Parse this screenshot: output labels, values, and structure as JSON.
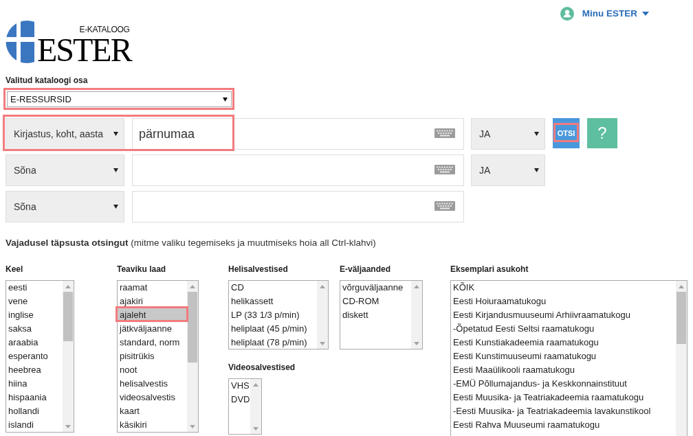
{
  "user_menu": {
    "label": "Minu ESTER"
  },
  "logo": {
    "subtitle": "E-KATALOOG",
    "title": "ESTER"
  },
  "catalog_section": {
    "label": "Valitud kataloogi osa",
    "value": "E-RESSURSID",
    "highlighted": true
  },
  "search_rows": [
    {
      "field": "Kirjastus, koht, aasta",
      "value": "pärnumaa",
      "operator": "JA",
      "highlighted": true
    },
    {
      "field": "Sõna",
      "operator": "JA",
      "highlighted": false
    },
    {
      "field": "Sõna",
      "highlighted": false
    }
  ],
  "search_button": {
    "label": "OTSI",
    "highlighted": true
  },
  "help_button": {
    "label": "?"
  },
  "refine_hint": "**Vajadusel täpsusta otsingut** (mitme valiku tegemiseks ja muutmiseks hoia all Ctrl-klahvi)",
  "filter_columns": [
    {
      "filters": [
        {
          "title": "Keel",
          "options": [
            {
              "label": "eesti",
              "selected": false,
              "highlighted": false
            },
            {
              "label": "vene",
              "selected": false,
              "highlighted": false
            },
            {
              "label": "inglise",
              "selected": false,
              "highlighted": false
            },
            {
              "label": "saksa",
              "selected": false,
              "highlighted": false
            },
            {
              "label": "araabia",
              "selected": false,
              "highlighted": false
            },
            {
              "label": "esperanto",
              "selected": false,
              "highlighted": false
            },
            {
              "label": "heebrea",
              "selected": false,
              "highlighted": false
            },
            {
              "label": "hiina",
              "selected": false,
              "highlighted": false
            },
            {
              "label": "hispaania",
              "selected": false,
              "highlighted": false
            },
            {
              "label": "hollandi",
              "selected": false,
              "highlighted": false
            },
            {
              "label": "islandi",
              "selected": false,
              "highlighted": false
            }
          ]
        }
      ]
    },
    {
      "filters": [
        {
          "title": "Teaviku laad",
          "options": [
            {
              "label": "raamat",
              "selected": false,
              "highlighted": false
            },
            {
              "label": "ajakiri",
              "selected": false,
              "highlighted": false
            },
            {
              "label": "ajaleht",
              "selected": true,
              "highlighted": true
            },
            {
              "label": "jätkväljaanne",
              "selected": false,
              "highlighted": false
            },
            {
              "label": "standard, norm",
              "selected": false,
              "highlighted": false
            },
            {
              "label": "pisitrükis",
              "selected": false,
              "highlighted": false
            },
            {
              "label": "noot",
              "selected": false,
              "highlighted": false
            },
            {
              "label": "helisalvestis",
              "selected": false,
              "highlighted": false
            },
            {
              "label": "videosalvestis",
              "selected": false,
              "highlighted": false
            },
            {
              "label": "kaart",
              "selected": false,
              "highlighted": false
            },
            {
              "label": "käsikiri",
              "selected": false,
              "highlighted": false
            }
          ]
        }
      ]
    },
    {
      "filters": [
        {
          "title": "Helisalvestised",
          "options": [
            {
              "label": "CD",
              "selected": false,
              "highlighted": false
            },
            {
              "label": "helikassett",
              "selected": false,
              "highlighted": false
            },
            {
              "label": "LP (33 1/3 p/min)",
              "selected": false,
              "highlighted": false
            },
            {
              "label": "heliplaat (45 p/min)",
              "selected": false,
              "highlighted": false
            },
            {
              "label": "heliplaat (78 p/min)",
              "selected": false,
              "highlighted": false
            }
          ]
        },
        {
          "title": "Videosalvestised",
          "options": [
            {
              "label": "VHS",
              "selected": false,
              "highlighted": false
            },
            {
              "label": "DVD",
              "selected": false,
              "highlighted": false
            }
          ]
        }
      ]
    },
    {
      "filters": [
        {
          "title": "E-väljaanded",
          "options": [
            {
              "label": "võrguväljaanne",
              "selected": false,
              "highlighted": false
            },
            {
              "label": "CD-ROM",
              "selected": false,
              "highlighted": false
            },
            {
              "label": "diskett",
              "selected": false,
              "highlighted": false
            }
          ]
        }
      ]
    },
    {
      "filters": [
        {
          "title": "Eksemplari asukoht",
          "options": [
            {
              "label": "KÕIK",
              "selected": false,
              "highlighted": false
            },
            {
              "label": "Eesti Hoiuraamatukogu",
              "selected": false,
              "highlighted": false
            },
            {
              "label": "Eesti Kirjandusmuuseumi Arhiivraamatukogu",
              "selected": false,
              "highlighted": false
            },
            {
              "label": "-Õpetatud Eesti Seltsi raamatukogu",
              "selected": false,
              "highlighted": false
            },
            {
              "label": "Eesti Kunstiakadeemia raamatukogu",
              "selected": false,
              "highlighted": false
            },
            {
              "label": "Eesti Kunstimuuseumi raamatukogu",
              "selected": false,
              "highlighted": false
            },
            {
              "label": "Eesti Maaülikooli raamatukogu",
              "selected": false,
              "highlighted": false
            },
            {
              "label": "-EMÜ Põllumajandus- ja Keskkonnainstituut",
              "selected": false,
              "highlighted": false
            },
            {
              "label": "Eesti Muusika- ja Teatriakadeemia raamatukogu",
              "selected": false,
              "highlighted": false
            },
            {
              "label": "-Eesti Muusika- ja Teatriakadeemia lavakunstikool",
              "selected": false,
              "highlighted": false
            },
            {
              "label": "Eesti Rahva Muuseumi raamatukogu",
              "selected": false,
              "highlighted": false
            }
          ]
        }
      ]
    }
  ]
}
